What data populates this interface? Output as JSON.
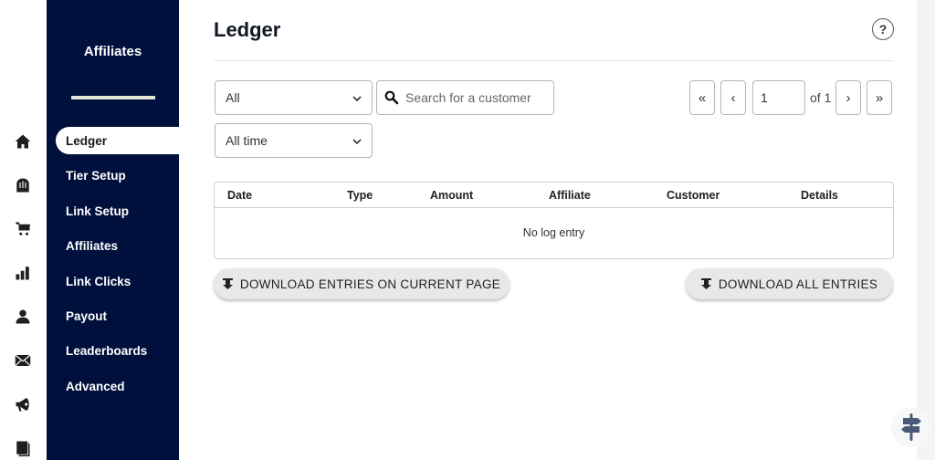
{
  "icon_rail": [
    {
      "name": "home-icon"
    },
    {
      "name": "store-icon"
    },
    {
      "name": "cart-icon"
    },
    {
      "name": "bar-chart-icon"
    },
    {
      "name": "user-icon"
    },
    {
      "name": "mail-icon"
    },
    {
      "name": "megaphone-icon"
    },
    {
      "name": "book-icon"
    }
  ],
  "sidebar": {
    "title": "Affiliates",
    "items": [
      {
        "label": "Ledger",
        "active": true
      },
      {
        "label": "Tier Setup"
      },
      {
        "label": "Link Setup"
      },
      {
        "label": "Affiliates"
      },
      {
        "label": "Link Clicks"
      },
      {
        "label": "Payout"
      },
      {
        "label": "Leaderboards"
      },
      {
        "label": "Advanced"
      }
    ]
  },
  "header": {
    "title": "Ledger",
    "help_label": "?"
  },
  "filters": {
    "type_select": "All",
    "time_select": "All time",
    "search_placeholder": "Search for a customer",
    "search_value": ""
  },
  "pagination": {
    "first": "«",
    "prev": "‹",
    "current_page": "1",
    "of_label": "of 1",
    "next": "›",
    "last": "»"
  },
  "table": {
    "columns": [
      "Date",
      "Type",
      "Amount",
      "Affiliate",
      "Customer",
      "Details"
    ],
    "rows": [],
    "empty_text": "No log entry"
  },
  "actions": {
    "download_current": "DOWNLOAD ENTRIES ON CURRENT PAGE",
    "download_all": "DOWNLOAD ALL ENTRIES"
  },
  "colors": {
    "sidebar_bg": "#00103d",
    "accent_divider": "#e0e3d6",
    "button_bg": "#e7e8ea",
    "fab_icon": "#4a5a7a"
  }
}
